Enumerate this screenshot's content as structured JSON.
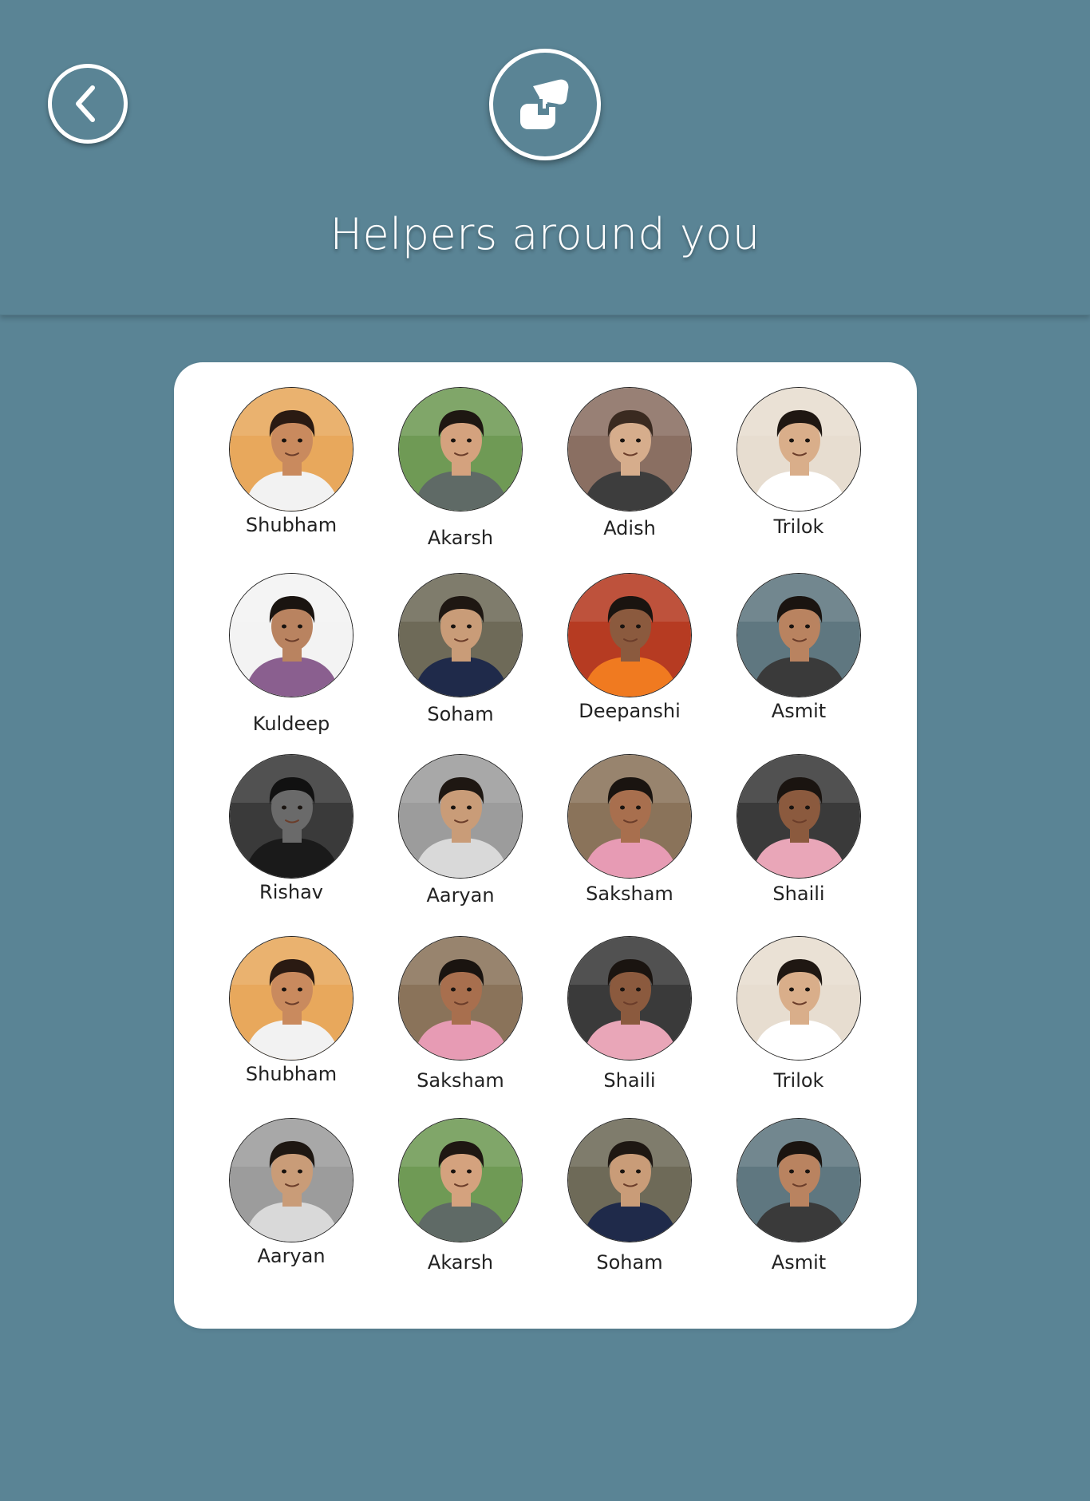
{
  "header": {
    "title": "Helpers around you",
    "back_icon": "chevron-left-icon",
    "logo_icon": "helping-hands-icon"
  },
  "colors": {
    "background": "#5a8495",
    "card": "#ffffff",
    "text": "#222222"
  },
  "helpers": [
    {
      "name": "Shubham",
      "bg": "#e8a85c",
      "skin": "#c98a5e",
      "hair": "#2a1a12",
      "shirt": "#f2f2f2"
    },
    {
      "name": "Akarsh",
      "bg": "#6f9a55",
      "skin": "#d4a27e",
      "hair": "#1e1712",
      "shirt": "#5f6a66"
    },
    {
      "name": "Adish",
      "bg": "#8a6f62",
      "skin": "#d6ad8c",
      "hair": "#3a2a20",
      "shirt": "#3d3d3d"
    },
    {
      "name": "Trilok",
      "bg": "#e7ddd0",
      "skin": "#d9ae8a",
      "hair": "#1f1712",
      "shirt": "#ffffff"
    },
    {
      "name": "Kuldeep",
      "bg": "#f3f3f3",
      "skin": "#b98360",
      "hair": "#1a1410",
      "shirt": "#8a5f8f"
    },
    {
      "name": "Soham",
      "bg": "#6e6a58",
      "skin": "#c99c78",
      "hair": "#1e1712",
      "shirt": "#1f2a4a"
    },
    {
      "name": "Deepanshi",
      "bg": "#b63b22",
      "skin": "#8b5a3e",
      "hair": "#1a1410",
      "shirt": "#f07a20"
    },
    {
      "name": "Asmit",
      "bg": "#5f7780",
      "skin": "#b98360",
      "hair": "#1a1410",
      "shirt": "#3a3a3a"
    },
    {
      "name": "Rishav",
      "bg": "#3a3a3a",
      "skin": "#6a6a6a",
      "hair": "#111111",
      "shirt": "#1a1a1a"
    },
    {
      "name": "Aaryan",
      "bg": "#9c9c9c",
      "skin": "#c99c78",
      "hair": "#1e1712",
      "shirt": "#d9d9d9"
    },
    {
      "name": "Saksham",
      "bg": "#8a735a",
      "skin": "#a86f4e",
      "hair": "#1a1410",
      "shirt": "#e79bb4"
    },
    {
      "name": "Shaili",
      "bg": "#3a3a3a",
      "skin": "#8b5a3e",
      "hair": "#1a1410",
      "shirt": "#e9a6b8"
    },
    {
      "name": "Shubham",
      "bg": "#e8a85c",
      "skin": "#c98a5e",
      "hair": "#2a1a12",
      "shirt": "#f2f2f2"
    },
    {
      "name": "Saksham",
      "bg": "#8a735a",
      "skin": "#a86f4e",
      "hair": "#1a1410",
      "shirt": "#e79bb4"
    },
    {
      "name": "Shaili",
      "bg": "#3a3a3a",
      "skin": "#8b5a3e",
      "hair": "#1a1410",
      "shirt": "#e9a6b8"
    },
    {
      "name": "Trilok",
      "bg": "#e7ddd0",
      "skin": "#d9ae8a",
      "hair": "#1f1712",
      "shirt": "#ffffff"
    },
    {
      "name": "Aaryan",
      "bg": "#9c9c9c",
      "skin": "#c99c78",
      "hair": "#1e1712",
      "shirt": "#d9d9d9"
    },
    {
      "name": "Akarsh",
      "bg": "#6f9a55",
      "skin": "#d4a27e",
      "hair": "#1e1712",
      "shirt": "#5f6a66"
    },
    {
      "name": "Soham",
      "bg": "#6e6a58",
      "skin": "#c99c78",
      "hair": "#1e1712",
      "shirt": "#1f2a4a"
    },
    {
      "name": "Asmit",
      "bg": "#5f7780",
      "skin": "#b98360",
      "hair": "#1a1410",
      "shirt": "#3a3a3a"
    }
  ]
}
